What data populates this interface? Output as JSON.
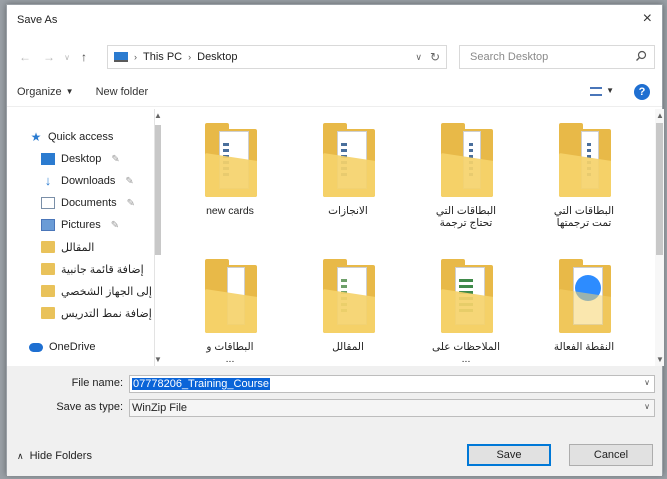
{
  "window": {
    "title": "Save As",
    "close_glyph": "×"
  },
  "address_bar": {
    "back_glyph": "←",
    "forward_glyph": "→",
    "up_glyph": "↑",
    "crumbs": [
      "This PC",
      "Desktop"
    ],
    "crumb_separator": "›",
    "dropdown_glyph": "∨",
    "refresh_glyph": "↻",
    "search_placeholder": "Search Desktop"
  },
  "toolbar": {
    "organize_label": "Organize",
    "new_folder_label": "New folder",
    "help_glyph": "?"
  },
  "nav_pane": {
    "items": [
      {
        "label": "Quick access",
        "icon": "star-icon",
        "pinned": false
      },
      {
        "label": "Desktop",
        "icon": "desktop-icon",
        "pinned": true
      },
      {
        "label": "Downloads",
        "icon": "downloads-icon",
        "pinned": true
      },
      {
        "label": "Documents",
        "icon": "documents-icon",
        "pinned": true
      },
      {
        "label": "Pictures",
        "icon": "pictures-icon",
        "pinned": true
      },
      {
        "label": "المقالل",
        "icon": "folder-icon",
        "pinned": false
      },
      {
        "label": "إضافة قائمة جانبية",
        "icon": "folder-icon",
        "pinned": false
      },
      {
        "label": "إلى الجهاز الشخصي",
        "icon": "folder-icon",
        "pinned": false
      },
      {
        "label": "إضافة نمط التدريس",
        "icon": "folder-icon",
        "pinned": false
      },
      {
        "label": "OneDrive",
        "icon": "cloud-icon",
        "pinned": false
      }
    ],
    "pin_glyph": "✎"
  },
  "files": [
    {
      "label": "new cards",
      "kind": "docs"
    },
    {
      "label": "الانجازات",
      "kind": "docs"
    },
    {
      "label": "البطاقات التي\nتحتاج ترجمة",
      "kind": "paper"
    },
    {
      "label": "البطاقات التي\nتمت ترجمتها",
      "kind": "paper"
    },
    {
      "label": "البطاقات و\n...",
      "kind": "paper"
    },
    {
      "label": "المقالل",
      "kind": "docs"
    },
    {
      "label": "الملاحظات على\n...",
      "kind": "sheet"
    },
    {
      "label": "النقطة الفعالة",
      "kind": "zoom"
    }
  ],
  "bottom": {
    "file_name_label": "File name:",
    "file_name_value": "07778206_Training_Course",
    "save_type_label": "Save as type:",
    "save_type_value": "WinZip File",
    "hide_folders_label": "Hide Folders",
    "save_button": "Save",
    "cancel_button": "Cancel"
  },
  "colors": {
    "accent": "#0078d7",
    "folder": "#e8b948",
    "selection": "#0a64d8"
  }
}
